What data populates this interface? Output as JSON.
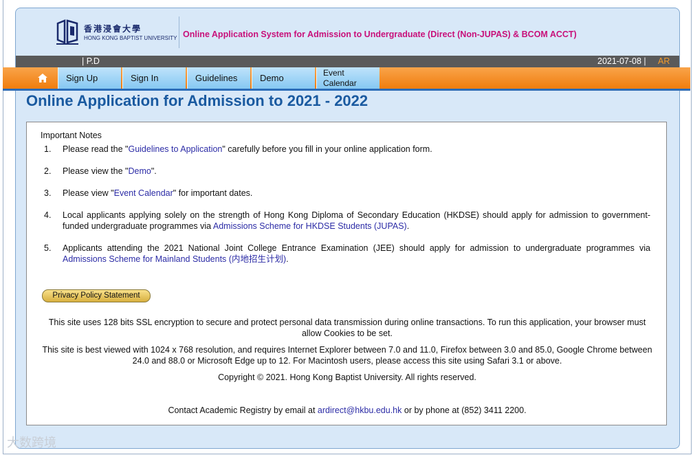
{
  "header": {
    "logo_cn": "香港浸會大學",
    "logo_en": "HONG KONG BAPTIST UNIVERSITY",
    "system_title": "Online Application System for Admission to Undergraduate (Direct (Non-JUPAS) & BCOM ACCT)"
  },
  "status_bar": {
    "user": "| P.D",
    "date": "2021-07-08 |",
    "language": "AR"
  },
  "nav": {
    "home_icon": "home-icon",
    "items": [
      {
        "label": "Sign Up"
      },
      {
        "label": "Sign In"
      },
      {
        "label": "Guidelines"
      },
      {
        "label": "Demo"
      },
      {
        "label_line1": "Event",
        "label_line2": "Calendar"
      }
    ]
  },
  "main": {
    "title": "Online Application for Admission to 2021 - 2022",
    "notes_heading": "Important Notes",
    "notes": [
      {
        "num": "1.",
        "pre": "Please read the \"",
        "link": "Guidelines to Application",
        "post": "\" carefully before you fill in your online application form."
      },
      {
        "num": "2.",
        "pre": "Please view the \"",
        "link": "Demo",
        "post": "\"."
      },
      {
        "num": "3.",
        "pre": "Please view \"",
        "link": "Event Calendar",
        "post": "\" for important dates."
      },
      {
        "num": "4.",
        "pre": "Local applicants applying solely on the strength of Hong Kong Diploma of Secondary Education (HKDSE) should apply for admission to government-funded undergraduate programmes via ",
        "link": "Admissions Scheme for HKDSE Students (JUPAS)",
        "post": "."
      },
      {
        "num": "5.",
        "pre": "Applicants attending the 2021 National Joint College Entrance Examination (JEE) should apply for admission to undergraduate programmes via ",
        "link": "Admissions Scheme for Mainland Students (内地招生计划)",
        "post": "."
      }
    ],
    "privacy_button": "Privacy Policy Statement",
    "ssl_text": "This site uses 128 bits SSL encryption to secure and protect personal data transmission during online transactions. To run this application, your browser must allow Cookies to be set.",
    "browser_text": "This site is best viewed with 1024 x 768 resolution, and requires Internet Explorer between 7.0 and 11.0, Firefox between 3.0 and 85.0, Google Chrome between 24.0 and 88.0 or Microsoft Edge up to 12. For Macintosh users, please access this site using Safari 3.1 or above.",
    "copyright": "Copyright © 2021. Hong Kong Baptist University. All rights reserved.",
    "contact_pre": "Contact Academic Registry by email at ",
    "contact_email": "ardirect@hkbu.edu.hk",
    "contact_post": " or by phone at (852) 3411 2200."
  },
  "watermark": "大数跨境",
  "colors": {
    "accent_magenta": "#c8107a",
    "nav_orange": "#f07d0d",
    "title_blue": "#1a5aa0",
    "link_blue": "#2c2ca6"
  }
}
